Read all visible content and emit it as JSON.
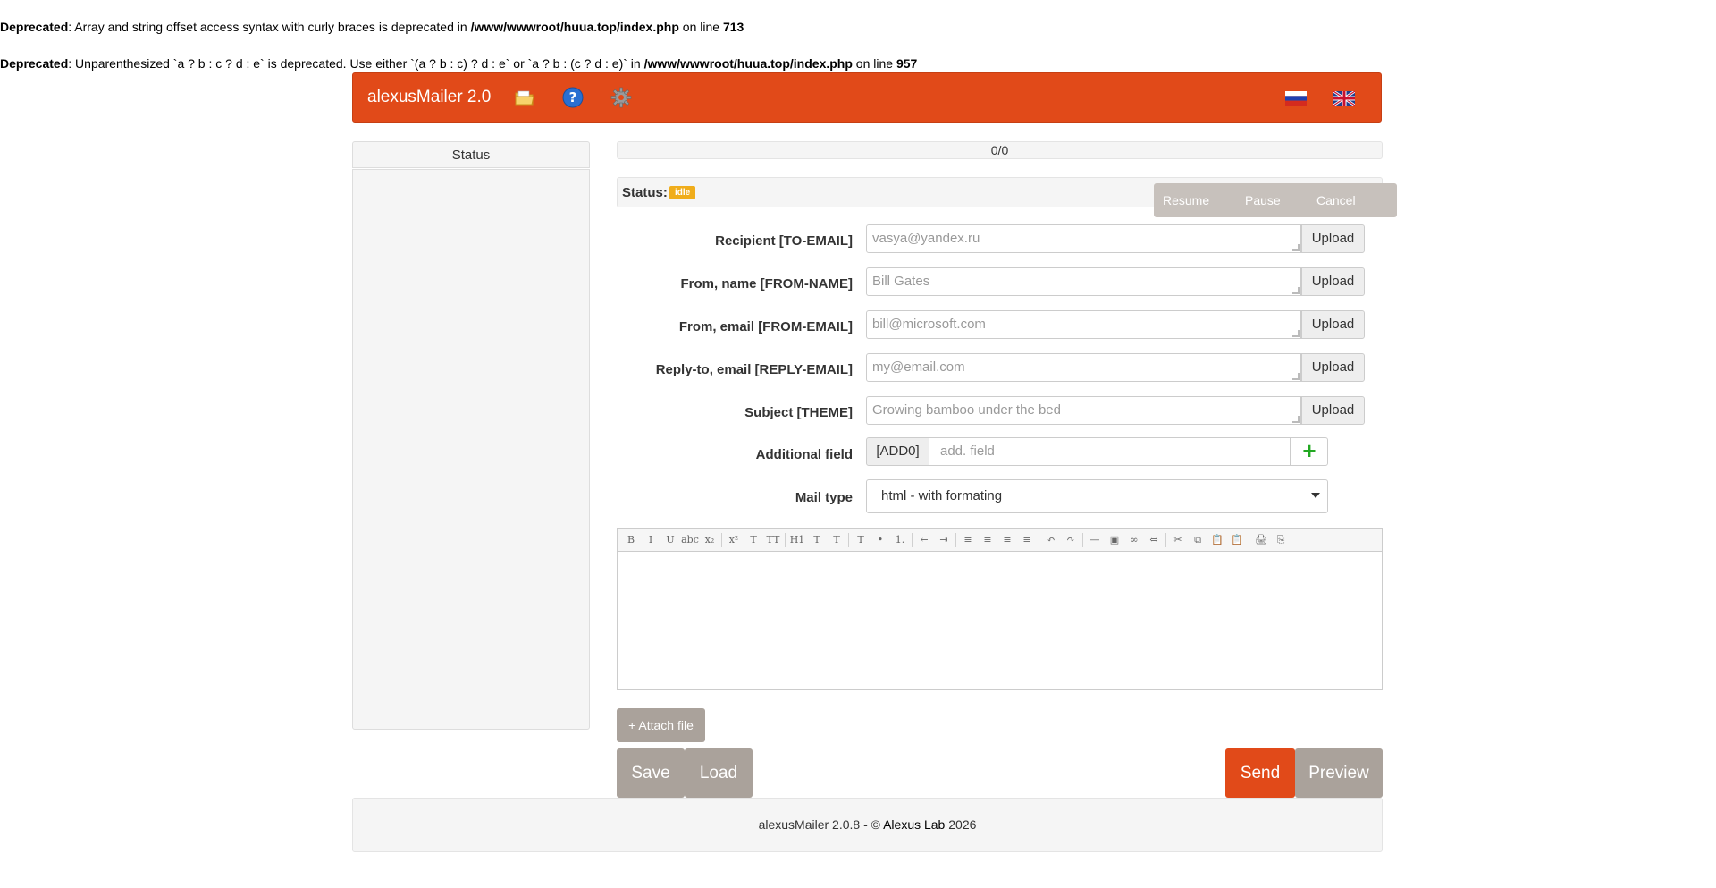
{
  "deprecations": [
    {
      "level": "Deprecated",
      "message": ": Array and string offset access syntax with curly braces is deprecated in ",
      "file": "/www/wwwroot/huua.top/index.php",
      "on_line_text": " on line ",
      "line": "713"
    },
    {
      "level": "Deprecated",
      "message": ": Unparenthesized `a ? b : c ? d : e` is deprecated. Use either `(a ? b : c) ? d : e` or `a ? b : (c ? d : e)` in ",
      "file": "/www/wwwroot/huua.top/index.php",
      "on_line_text": " on line ",
      "line": "957"
    }
  ],
  "header": {
    "brand": "alexusMailer 2.0",
    "icons": [
      "folder-icon",
      "help-icon",
      "gear-icon"
    ],
    "flags": [
      "flag-ru-icon",
      "flag-gb-icon"
    ],
    "brand_color": "#e14a19"
  },
  "status_panel": {
    "title": "Status"
  },
  "progress": {
    "text": "0/0",
    "value": 0
  },
  "status_bar": {
    "label": "Status:",
    "badge": "idle",
    "badge_color": "#f0ad1b",
    "resume": " Resume",
    "pause": " Pause",
    "cancel": " Cancel"
  },
  "form": {
    "upload_label": "Upload",
    "fields": [
      {
        "label": "Recipient [TO-EMAIL]",
        "placeholder": "vasya@yandex.ru"
      },
      {
        "label": "From, name [FROM-NAME]",
        "placeholder": "Bill Gates"
      },
      {
        "label": "From, email [FROM-EMAIL]",
        "placeholder": "bill@microsoft.com"
      },
      {
        "label": "Reply-to, email [REPLY-EMAIL]",
        "placeholder": "my@email.com"
      },
      {
        "label": "Subject [THEME]",
        "placeholder": "Growing bamboo under the bed"
      }
    ],
    "additional": {
      "label": "Additional field",
      "addon": "[ADD0]",
      "placeholder": "add. field",
      "plus": "+"
    },
    "mail_type": {
      "label": "Mail type",
      "selected": "html - with formating"
    }
  },
  "editor": {
    "toolbar": [
      "B",
      "I",
      "U",
      "abc",
      "x₂",
      "x²",
      "T",
      "TT",
      "H1",
      "T",
      "T",
      "T",
      "•",
      "1.",
      "⇤",
      "⇥",
      "≡",
      "≡",
      "≡",
      "≡",
      "↶",
      "↷",
      "—",
      "▣",
      "∞",
      "⇔",
      "✂",
      "⧉",
      "📋",
      "📋",
      "🖨",
      "⎘"
    ]
  },
  "actions": {
    "attach": "+ Attach file",
    "save": "Save",
    "load": "Load",
    "send": "Send",
    "preview": "Preview"
  },
  "footer": {
    "prefix": "alexusMailer 2.0.8 - © ",
    "link": "Alexus Lab",
    "year": " 2026"
  }
}
